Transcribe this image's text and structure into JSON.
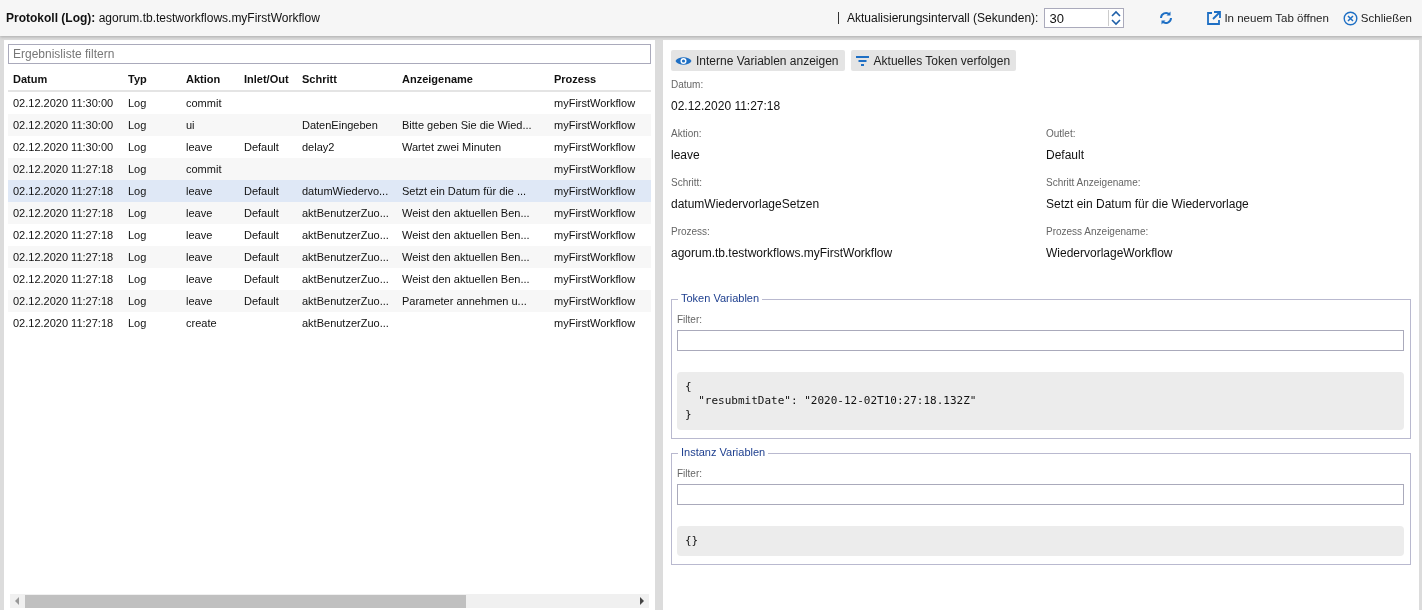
{
  "header": {
    "title": "Protokoll (Log):",
    "subtitle": "agorum.tb.testworkflows.myFirstWorkflow",
    "interval_label": "Aktualisierungsintervall (Sekunden):",
    "interval_value": "30",
    "open_tab": "In neuem Tab öffnen",
    "close": "Schließen"
  },
  "filter": {
    "placeholder": "Ergebnisliste filtern"
  },
  "table": {
    "columns": [
      "Datum",
      "Typ",
      "Aktion",
      "Inlet/Out",
      "Schritt",
      "Anzeigename",
      "Prozess"
    ],
    "rows": [
      {
        "selected": false,
        "cells": [
          "02.12.2020 11:30:00",
          "Log",
          "commit",
          "",
          "",
          "",
          "myFirstWorkflow"
        ]
      },
      {
        "selected": false,
        "cells": [
          "02.12.2020 11:30:00",
          "Log",
          "ui",
          "",
          "DatenEingeben",
          "Bitte geben Sie die Wied...",
          "myFirstWorkflow"
        ]
      },
      {
        "selected": false,
        "cells": [
          "02.12.2020 11:30:00",
          "Log",
          "leave",
          "Default",
          "delay2",
          "Wartet zwei Minuten",
          "myFirstWorkflow"
        ]
      },
      {
        "selected": false,
        "cells": [
          "02.12.2020 11:27:18",
          "Log",
          "commit",
          "",
          "",
          "",
          "myFirstWorkflow"
        ]
      },
      {
        "selected": true,
        "cells": [
          "02.12.2020 11:27:18",
          "Log",
          "leave",
          "Default",
          "datumWiedervo...",
          "Setzt ein Datum für die ...",
          "myFirstWorkflow"
        ]
      },
      {
        "selected": false,
        "cells": [
          "02.12.2020 11:27:18",
          "Log",
          "leave",
          "Default",
          "aktBenutzerZuo...",
          "Weist den aktuellen Ben...",
          "myFirstWorkflow"
        ]
      },
      {
        "selected": false,
        "cells": [
          "02.12.2020 11:27:18",
          "Log",
          "leave",
          "Default",
          "aktBenutzerZuo...",
          "Weist den aktuellen Ben...",
          "myFirstWorkflow"
        ]
      },
      {
        "selected": false,
        "cells": [
          "02.12.2020 11:27:18",
          "Log",
          "leave",
          "Default",
          "aktBenutzerZuo...",
          "Weist den aktuellen Ben...",
          "myFirstWorkflow"
        ]
      },
      {
        "selected": false,
        "cells": [
          "02.12.2020 11:27:18",
          "Log",
          "leave",
          "Default",
          "aktBenutzerZuo...",
          "Weist den aktuellen Ben...",
          "myFirstWorkflow"
        ]
      },
      {
        "selected": false,
        "cells": [
          "02.12.2020 11:27:18",
          "Log",
          "leave",
          "Default",
          "aktBenutzerZuo...",
          "Parameter annehmen u...",
          "myFirstWorkflow"
        ]
      },
      {
        "selected": false,
        "cells": [
          "02.12.2020 11:27:18",
          "Log",
          "create",
          "",
          "aktBenutzerZuo...",
          "",
          "myFirstWorkflow"
        ]
      }
    ]
  },
  "detail": {
    "buttons": [
      "Interne Variablen anzeigen",
      "Aktuelles Token verfolgen"
    ],
    "fields": [
      {
        "label": "Datum:",
        "value": "02.12.2020 11:27:18"
      },
      {
        "label": "Aktion:",
        "value": "leave"
      },
      {
        "label": "Outlet:",
        "value": "Default"
      },
      {
        "label": "Schritt:",
        "value": "datumWiedervorlageSetzen"
      },
      {
        "label": "Schritt Anzeigename:",
        "value": "Setzt ein Datum für die Wiedervorlage"
      },
      {
        "label": "Prozess:",
        "value": "agorum.tb.testworkflows.myFirstWorkflow"
      },
      {
        "label": "Prozess Anzeigename:",
        "value": "WiedervorlageWorkflow"
      }
    ],
    "groups": [
      {
        "title": "Token Variablen",
        "filter_label": "Filter:",
        "code": "{\n  \"resubmitDate\": \"2020-12-02T10:27:18.132Z\"\n}"
      },
      {
        "title": "Instanz Variablen",
        "filter_label": "Filter:",
        "code": "{}"
      }
    ]
  }
}
